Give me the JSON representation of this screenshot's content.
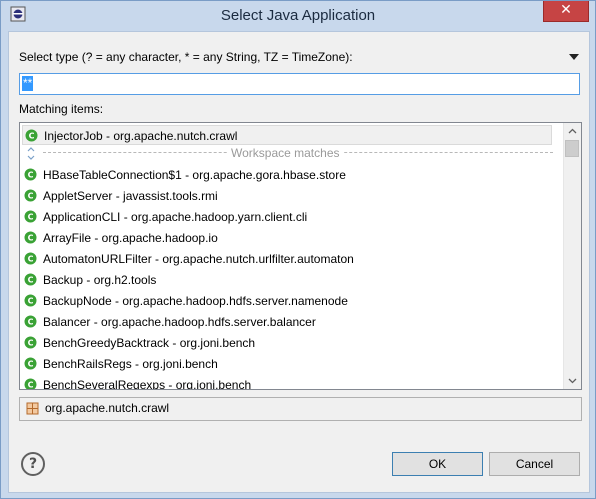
{
  "window": {
    "title": "Select Java Application",
    "close_glyph": "✕"
  },
  "filter": {
    "label": "Select type (? = any character, * = any String, TZ = TimeZone):",
    "value": "**"
  },
  "matching": {
    "label": "Matching items:",
    "history_item": "InjectorJob - org.apache.nutch.crawl",
    "separator": "Workspace matches",
    "items": [
      "HBaseTableConnection$1 - org.apache.gora.hbase.store",
      "AppletServer - javassist.tools.rmi",
      "ApplicationCLI - org.apache.hadoop.yarn.client.cli",
      "ArrayFile - org.apache.hadoop.io",
      "AutomatonURLFilter - org.apache.nutch.urlfilter.automaton",
      "Backup - org.h2.tools",
      "BackupNode - org.apache.hadoop.hdfs.server.namenode",
      "Balancer - org.apache.hadoop.hdfs.server.balancer",
      "BenchGreedyBacktrack - org.joni.bench",
      "BenchRailsRegs - org.joni.bench",
      "BenchSeveralRegexps - org.joni.bench"
    ]
  },
  "package": {
    "value": "org.apache.nutch.crawl",
    "icon": "package-icon"
  },
  "buttons": {
    "ok": "OK",
    "cancel": "Cancel",
    "help": "?"
  },
  "colors": {
    "selection": "#3399ff",
    "focus_border": "#569de5",
    "class_icon": "#3aa235",
    "title_bg": "#c8d8ec"
  }
}
